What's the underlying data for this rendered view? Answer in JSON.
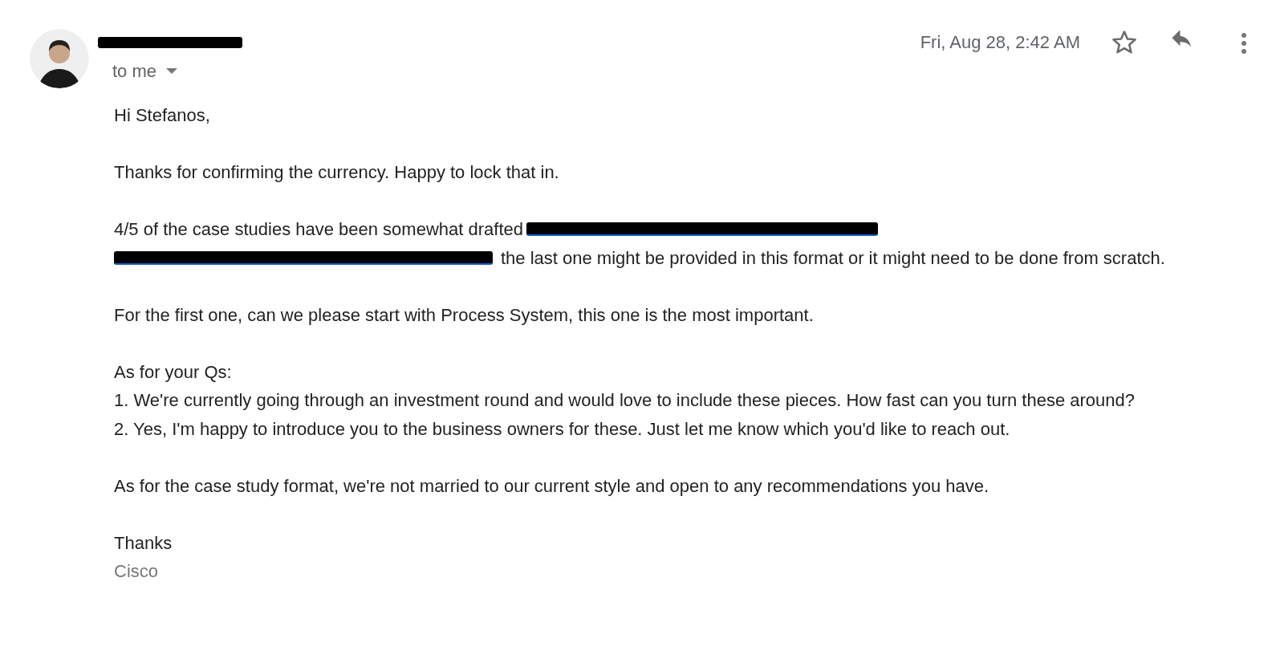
{
  "header": {
    "to_label": "to me",
    "date": "Fri, Aug 28, 2:42 AM",
    "starred": false
  },
  "body": [
    {
      "kind": "text",
      "text": "Hi Stefanos,"
    },
    {
      "kind": "text",
      "text": "Thanks for confirming the currency. Happy to lock that in."
    },
    {
      "kind": "redacted_link",
      "before": "4/5 of the case studies have been somewhat drafted",
      "after": "the last one might be provided in this format or it might need to be done from scratch."
    },
    {
      "kind": "text",
      "text": "For the first one, can we please start with Process System, this one is the most important."
    },
    {
      "kind": "lines",
      "lines": [
        "As for your Qs:",
        "1. We're currently going through an investment round and would love to include these pieces.  How fast can you turn these around?",
        "2. Yes, I'm happy to introduce you to the business owners for these. Just let me know which you'd like to reach out."
      ]
    },
    {
      "kind": "text",
      "text": "As for the case study format, we're not married to our current style and open to any recommendations you have."
    },
    {
      "kind": "signature",
      "closing": "Thanks",
      "name": "Cisco"
    }
  ]
}
